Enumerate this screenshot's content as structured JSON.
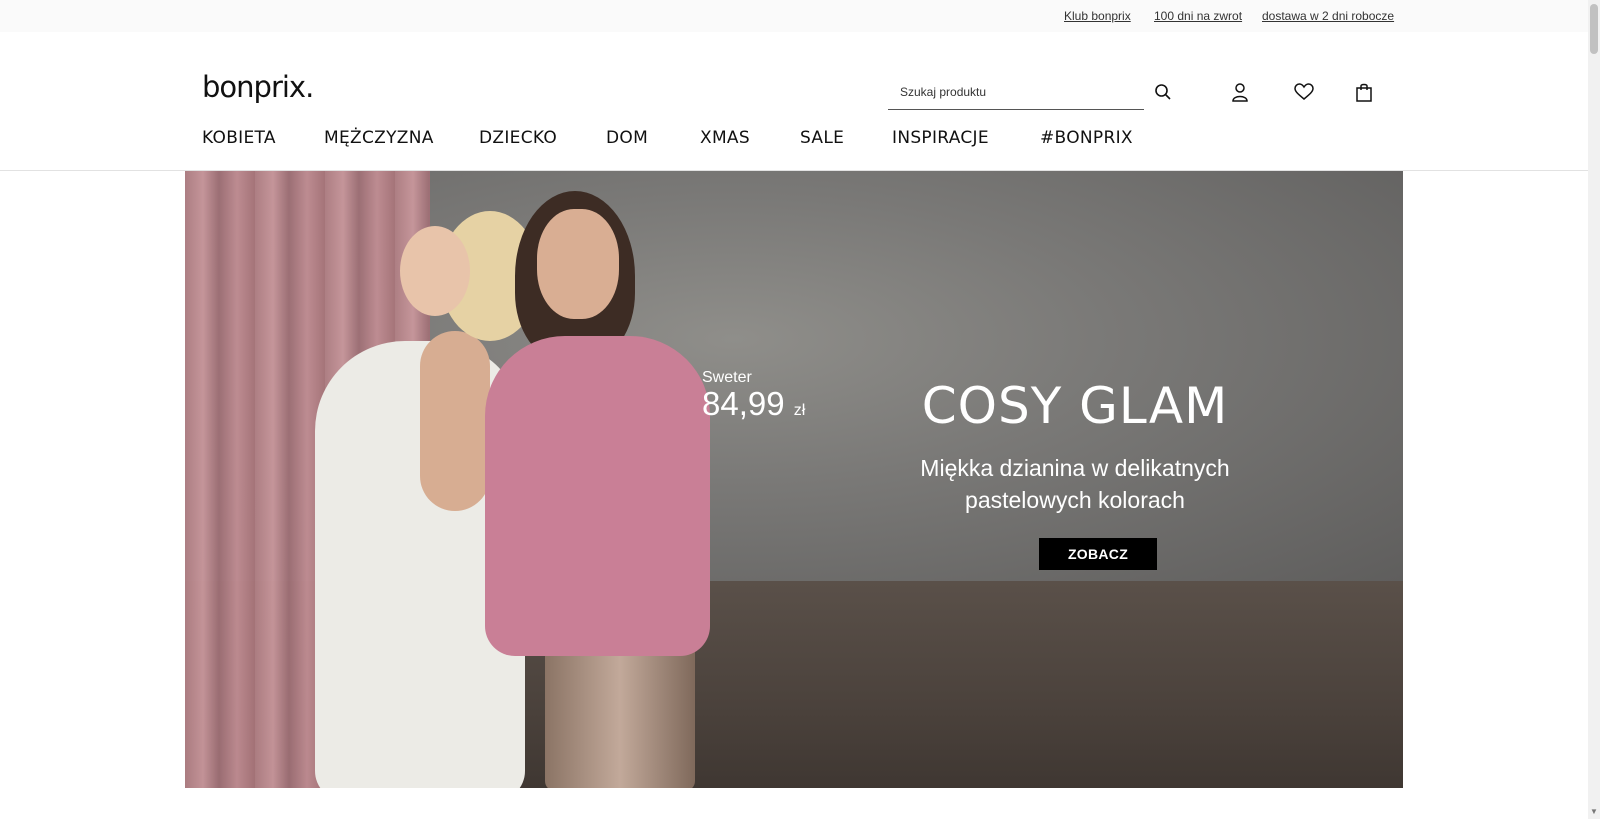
{
  "topbar": {
    "links": [
      "Klub bonprix",
      "100 dni na zwrot",
      "dostawa w 2 dni robocze"
    ]
  },
  "header": {
    "logo": "bonprix.",
    "search_placeholder": "Szukaj produktu",
    "icons": [
      "search-icon",
      "user-icon",
      "heart-icon",
      "bag-icon"
    ]
  },
  "nav": {
    "items": [
      "KOBIETA",
      "MĘŻCZYZNA",
      "DZIECKO",
      "DOM",
      "XMAS",
      "SALE",
      "INSPIRACJE",
      "#BONPRIX"
    ]
  },
  "hero": {
    "product_label": "Sweter",
    "price": "84,99",
    "currency": "zł",
    "headline": "COSY GLAM",
    "subline": "Miękka dzianina w delikatnych pastelowych kolorach",
    "cta": "ZOBACZ"
  },
  "colors": {
    "cta_bg": "#000000",
    "text": "#111111"
  }
}
